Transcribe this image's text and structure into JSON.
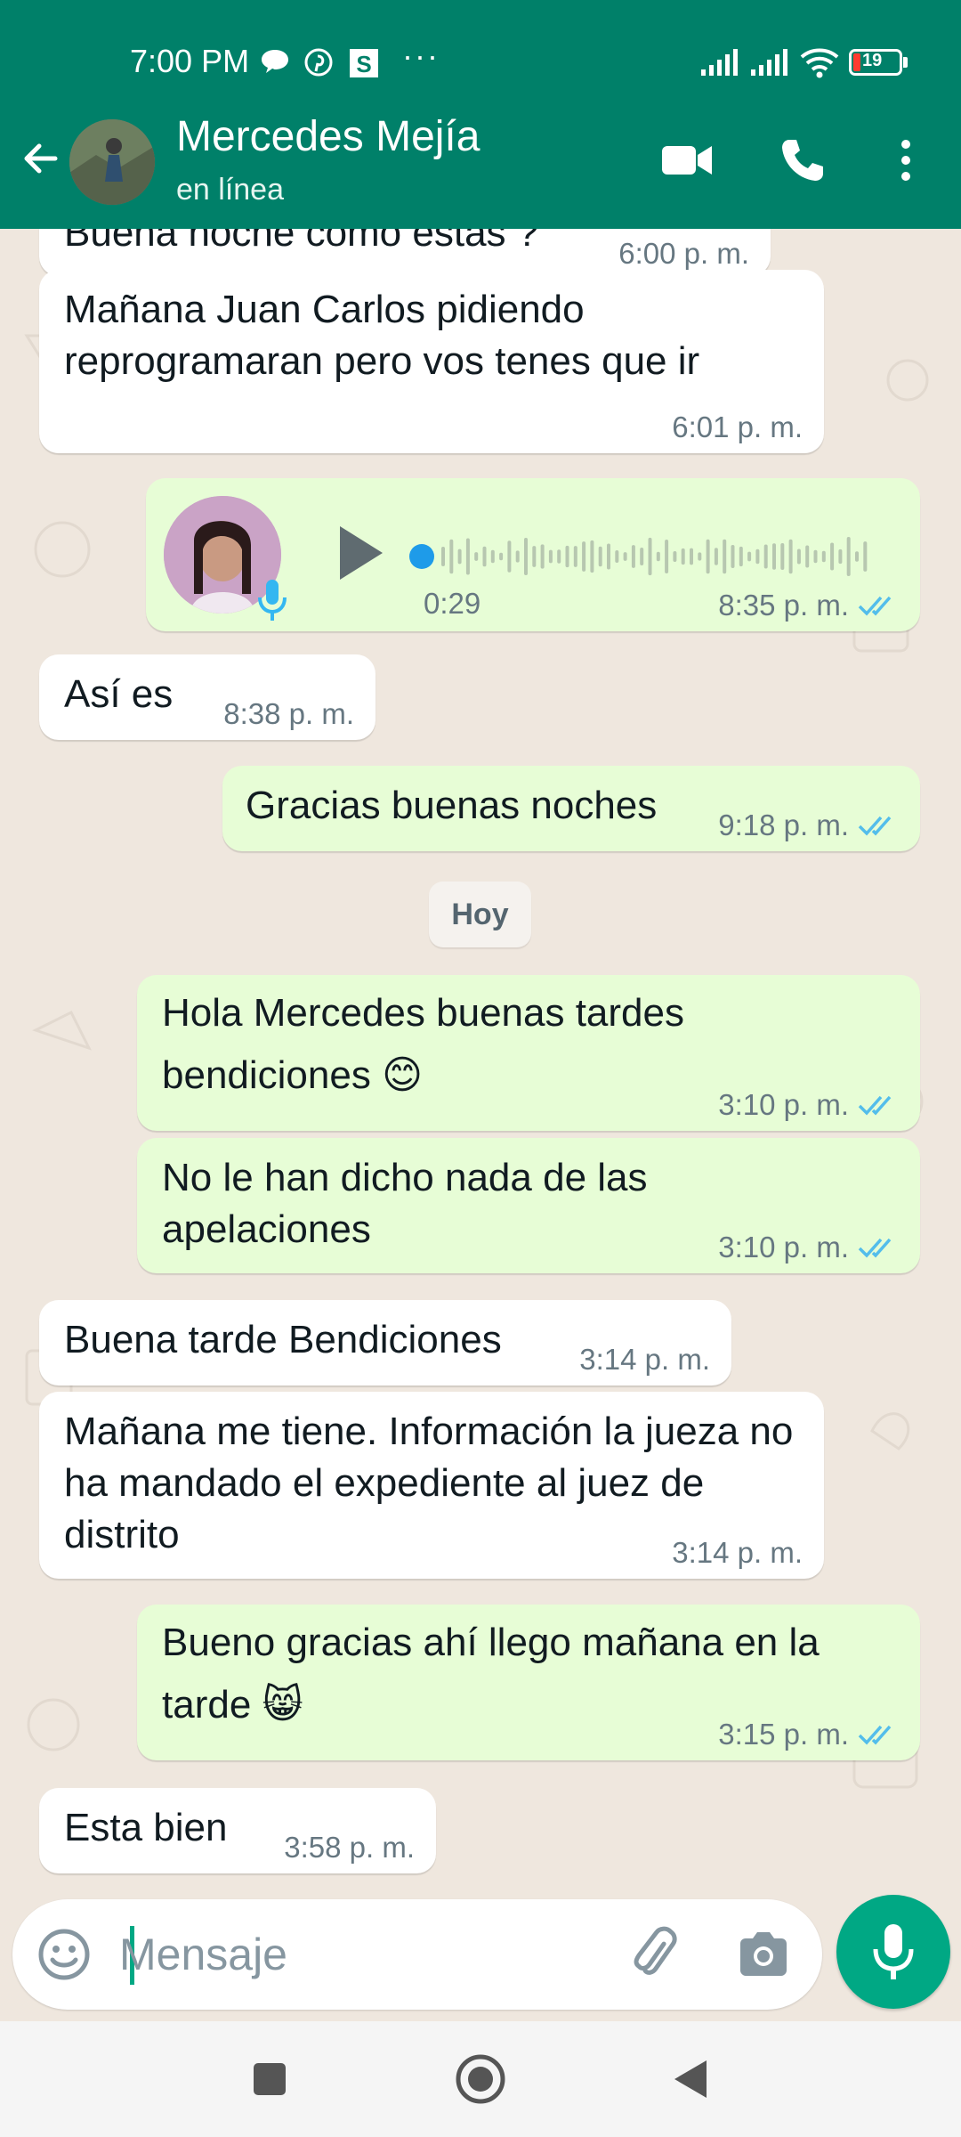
{
  "status_bar": {
    "time": "7:00 PM",
    "battery": "19",
    "overflow": "···",
    "icons": [
      "chat-bubble-icon",
      "pinterest-icon",
      "s-app-icon",
      "signal-icon",
      "signal-icon",
      "wifi-icon",
      "battery-icon"
    ]
  },
  "header": {
    "contact_name": "Mercedes Mejía",
    "contact_status": "en línea",
    "icons": [
      "back-arrow-icon",
      "video-call-icon",
      "phone-icon",
      "more-vert-icon"
    ]
  },
  "messages": [
    {
      "dir": "in",
      "text": "Buena noche como estás ?",
      "time": "6:00 p. m."
    },
    {
      "dir": "in",
      "text": "Mañana Juan Carlos pidiendo reprogramaran pero vos tenes que ir",
      "time": "6:01 p. m."
    },
    {
      "dir": "out",
      "type": "voice",
      "duration": "0:29",
      "time": "8:35 p. m.",
      "read": true
    },
    {
      "dir": "in",
      "text": "Así es",
      "time": "8:38 p. m."
    },
    {
      "dir": "out",
      "text": "Gracias buenas noches",
      "time": "9:18 p. m.",
      "read": true
    },
    {
      "type": "date",
      "text": "Hoy"
    },
    {
      "dir": "out",
      "text": "Hola Mercedes buenas tardes bendiciones 😊",
      "time": "3:10 p. m.",
      "read": true
    },
    {
      "dir": "out",
      "text": "No le han dicho nada de las apelaciones",
      "time": "3:10 p. m.",
      "read": true
    },
    {
      "dir": "in",
      "text": "Buena tarde Bendiciones",
      "time": "3:14 p. m."
    },
    {
      "dir": "in",
      "text": "Mañana me tiene. Información la jueza no ha mandado el expediente al juez de distrito",
      "time": "3:14 p. m."
    },
    {
      "dir": "out",
      "text": "Bueno gracias ahí llego mañana en la tarde 😸",
      "time": "3:15 p. m.",
      "read": true
    },
    {
      "dir": "in",
      "text": "Esta bien",
      "time": "3:58 p. m."
    }
  ],
  "composer": {
    "placeholder": "Mensaje",
    "icons": [
      "emoji-icon",
      "attach-icon",
      "camera-icon",
      "mic-icon"
    ]
  },
  "colors": {
    "header": "#008069",
    "accent": "#00a884",
    "outgoing_bubble": "#e7fdd6",
    "incoming_bubble": "#ffffff",
    "read_ticks": "#53bdeb",
    "chat_background": "#efe7de"
  }
}
